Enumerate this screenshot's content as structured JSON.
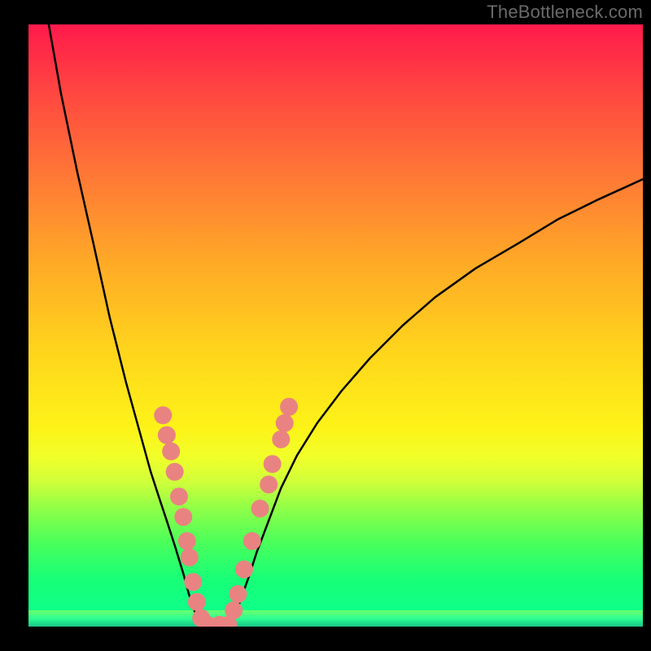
{
  "watermark": "TheBottleneck.com",
  "chart_data": {
    "type": "line",
    "title": "",
    "xlabel": "",
    "ylabel": "",
    "xlim": [
      0,
      100
    ],
    "ylim": [
      0,
      100
    ],
    "grid": false,
    "legend": false,
    "gradient_stops": [
      {
        "pos": 0,
        "color": "#ff1a4b"
      },
      {
        "pos": 12,
        "color": "#ff4940"
      },
      {
        "pos": 26,
        "color": "#ff7b35"
      },
      {
        "pos": 40,
        "color": "#ffab26"
      },
      {
        "pos": 54,
        "color": "#ffd41c"
      },
      {
        "pos": 67,
        "color": "#fdf318"
      },
      {
        "pos": 72,
        "color": "#f0ff2a"
      },
      {
        "pos": 76,
        "color": "#cfff3a"
      },
      {
        "pos": 80,
        "color": "#94ff46"
      },
      {
        "pos": 86,
        "color": "#4bff5b"
      },
      {
        "pos": 92,
        "color": "#18ff77"
      },
      {
        "pos": 100,
        "color": "#0aff91"
      }
    ],
    "series": [
      {
        "name": "left-curve",
        "color": "#000000",
        "x": [
          3.3,
          5.3,
          7.9,
          10.6,
          13.2,
          15.9,
          17.9,
          19.9,
          21.2,
          22.5,
          23.8,
          25.2,
          26.1,
          27.0,
          27.8
        ],
        "y": [
          100,
          88.5,
          75.7,
          63.5,
          51.4,
          40.5,
          33.1,
          25.7,
          21.6,
          17.6,
          13.5,
          8.8,
          5.4,
          2.7,
          0.0
        ]
      },
      {
        "name": "floor-segment",
        "color": "#000000",
        "x": [
          27.8,
          33.1
        ],
        "y": [
          0.0,
          0.0
        ]
      },
      {
        "name": "right-curve",
        "color": "#000000",
        "x": [
          33.1,
          34.4,
          35.8,
          37.1,
          39.1,
          41.1,
          43.7,
          47.0,
          51.0,
          55.6,
          60.9,
          66.2,
          72.8,
          79.5,
          86.1,
          92.7,
          100.0
        ],
        "y": [
          0.0,
          4.1,
          8.1,
          12.2,
          17.6,
          23.0,
          28.4,
          33.8,
          39.2,
          44.6,
          50.0,
          54.7,
          59.5,
          63.5,
          67.6,
          70.9,
          74.3
        ]
      }
    ],
    "scatter": {
      "name": "markers",
      "color": "#e98381",
      "radius_px": 11,
      "points": [
        {
          "x": 21.9,
          "y": 35.1
        },
        {
          "x": 22.5,
          "y": 31.8
        },
        {
          "x": 23.2,
          "y": 29.1
        },
        {
          "x": 23.8,
          "y": 25.7
        },
        {
          "x": 24.5,
          "y": 21.6
        },
        {
          "x": 25.2,
          "y": 18.2
        },
        {
          "x": 25.8,
          "y": 14.2
        },
        {
          "x": 26.2,
          "y": 11.5
        },
        {
          "x": 26.8,
          "y": 7.4
        },
        {
          "x": 27.4,
          "y": 4.1
        },
        {
          "x": 28.1,
          "y": 1.4
        },
        {
          "x": 29.1,
          "y": 0.3
        },
        {
          "x": 31.1,
          "y": 0.3
        },
        {
          "x": 32.5,
          "y": 0.3
        },
        {
          "x": 33.4,
          "y": 2.7
        },
        {
          "x": 34.1,
          "y": 5.4
        },
        {
          "x": 35.1,
          "y": 9.5
        },
        {
          "x": 36.4,
          "y": 14.2
        },
        {
          "x": 37.7,
          "y": 19.6
        },
        {
          "x": 39.1,
          "y": 23.6
        },
        {
          "x": 39.7,
          "y": 27.0
        },
        {
          "x": 41.1,
          "y": 31.1
        },
        {
          "x": 41.7,
          "y": 33.8
        },
        {
          "x": 42.4,
          "y": 36.5
        }
      ]
    }
  }
}
